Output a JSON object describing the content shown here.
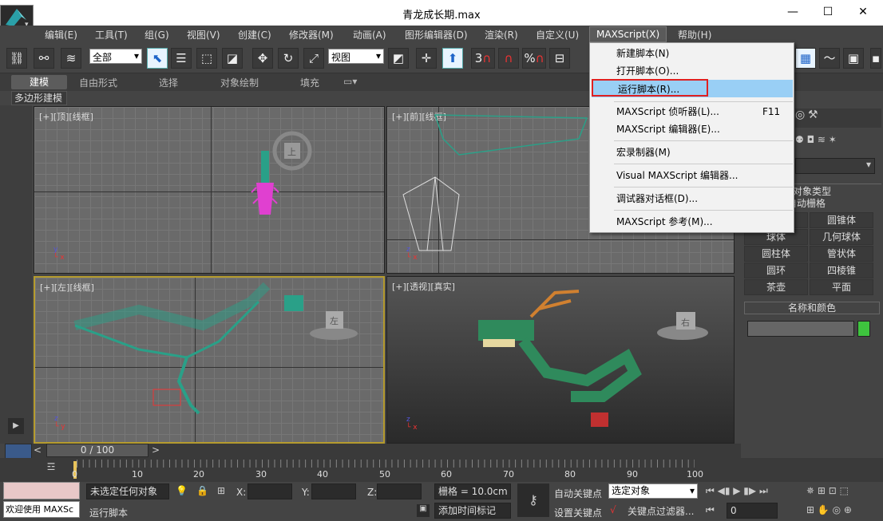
{
  "window": {
    "title": "青龙成长期.max",
    "minimize": "—",
    "maximize": "☐",
    "close": "✕"
  },
  "menu": {
    "items": [
      "编辑(E)",
      "工具(T)",
      "组(G)",
      "视图(V)",
      "创建(C)",
      "修改器(M)",
      "动画(A)",
      "图形编辑器(D)",
      "渲染(R)",
      "自定义(U)",
      "MAXScript(X)",
      "帮助(H)"
    ]
  },
  "toolbar": {
    "selection_filter": "全部",
    "ref_coord": "视图",
    "snap_3": "3",
    "snap_angle": "%"
  },
  "ribbon": {
    "tabs": [
      "建模",
      "自由形式",
      "选择",
      "对象绘制",
      "填充"
    ],
    "sub": "多边形建模"
  },
  "viewports": {
    "top": {
      "label": "[+][顶][线框]",
      "cube": "上"
    },
    "front": {
      "label": "[+][前][线框]"
    },
    "left": {
      "label": "[+][左][线框]",
      "cube": "左"
    },
    "persp": {
      "label": "[+][透视][真实]",
      "cube": "右"
    }
  },
  "maxscript_menu": {
    "items": [
      {
        "label": "新建脚本(N)",
        "shortcut": ""
      },
      {
        "label": "打开脚本(O)...",
        "shortcut": ""
      },
      {
        "label": "运行脚本(R)...",
        "shortcut": ""
      },
      {
        "label": "MAXScript 侦听器(L)...",
        "shortcut": "F11"
      },
      {
        "label": "MAXScript 编辑器(E)...",
        "shortcut": ""
      },
      {
        "label": "宏录制器(M)",
        "shortcut": ""
      },
      {
        "label": "Visual MAXScript 编辑器...",
        "shortcut": ""
      },
      {
        "label": "调试器对话框(D)...",
        "shortcut": ""
      },
      {
        "label": "MAXScript 参考(M)...",
        "shortcut": ""
      }
    ]
  },
  "command_panel": {
    "section_object_type": "对象类型",
    "auto_grid": "自动栅格",
    "primitives": [
      "球体",
      "几何球体",
      "圆柱体",
      "管状体",
      "圆环",
      "四棱锥",
      "茶壶",
      "平面"
    ],
    "top_right_prim": "圆锥体",
    "section_name_color": "名称和颜色",
    "name_color_hex": "#3ec43e"
  },
  "timeline": {
    "frame": "0 / 100",
    "ticks": [
      "0",
      "10",
      "20",
      "30",
      "40",
      "50",
      "60",
      "70",
      "80",
      "90",
      "100"
    ]
  },
  "status": {
    "welcome": "欢迎使用 MAXSc",
    "selection": "未选定任何对象",
    "prompt": "运行脚本",
    "x_label": "X:",
    "y_label": "Y:",
    "z_label": "Z:",
    "grid": "栅格 = 10.0cm",
    "add_time_tag": "添加时间标记",
    "auto_key": "自动关键点",
    "set_key": "设置关键点",
    "selected_object": "选定对象",
    "key_filter": "关键点过滤器...",
    "frame_field": "0"
  }
}
